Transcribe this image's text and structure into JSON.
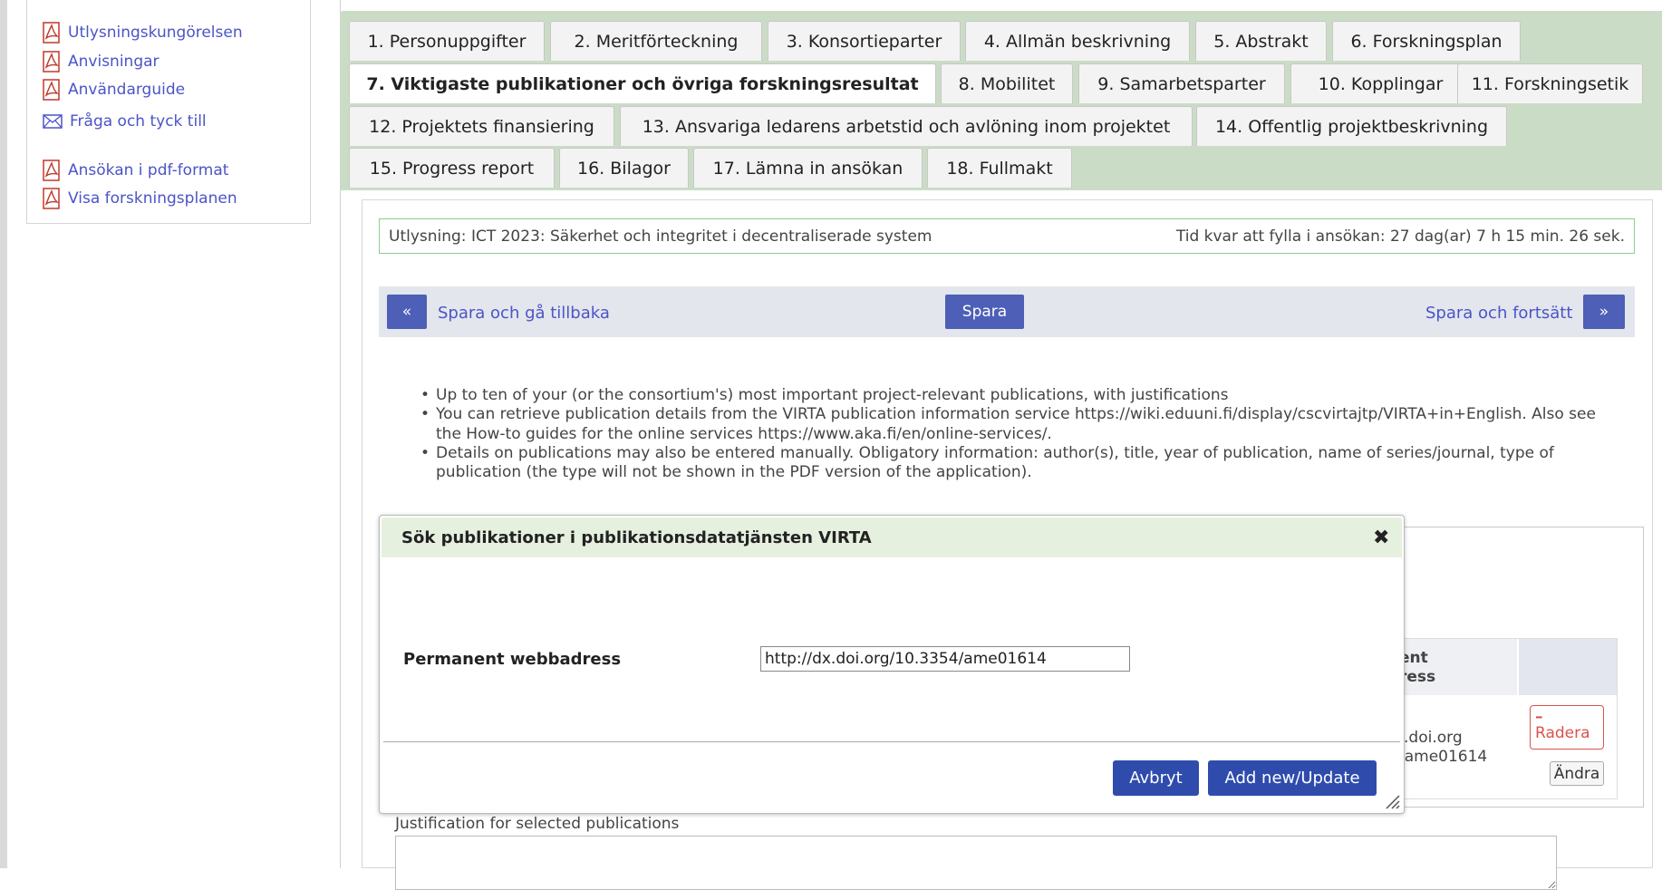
{
  "sidebar": {
    "links": [
      {
        "label": "Utlysningskungörelsen",
        "icon": "pdf-icon"
      },
      {
        "label": "Anvisningar",
        "icon": "pdf-icon"
      },
      {
        "label": "Användarguide",
        "icon": "pdf-icon"
      },
      {
        "label": "Fråga och tyck till",
        "icon": "mail-icon"
      },
      {
        "label": "Ansökan i pdf-format",
        "icon": "pdf-icon"
      },
      {
        "label": "Visa forskningsplanen",
        "icon": "pdf-icon"
      }
    ]
  },
  "tabs": [
    {
      "label": "1. Personuppgifter"
    },
    {
      "label": "2. Meritförteckning"
    },
    {
      "label": "3. Konsortieparter"
    },
    {
      "label": "4. Allmän beskrivning"
    },
    {
      "label": "5. Abstrakt"
    },
    {
      "label": "6. Forskningsplan"
    },
    {
      "label": "7. Viktigaste publikationer och övriga forskningsresultat",
      "active": true
    },
    {
      "label": "8. Mobilitet"
    },
    {
      "label": "9. Samarbetsparter"
    },
    {
      "label": "10. Kopplingar"
    },
    {
      "label": "11. Forskningsetik"
    },
    {
      "label": "12. Projektets finansiering"
    },
    {
      "label": "13. Ansvariga ledarens arbetstid och avlöning inom projektet"
    },
    {
      "label": "14. Offentlig projektbeskrivning"
    },
    {
      "label": "15. Progress report"
    },
    {
      "label": "16. Bilagor"
    },
    {
      "label": "17. Lämna in ansökan"
    },
    {
      "label": "18. Fullmakt"
    }
  ],
  "call": {
    "title": "Utlysning: ICT 2023: Säkerhet och integritet i decentraliserade system",
    "time_left": "Tid kvar att fylla i ansökan: 27 dag(ar) 7 h 15 min. 26 sek."
  },
  "nav": {
    "back_icon": "«",
    "back_label": "Spara och gå tillbaka",
    "save_label": "Spara",
    "forward_label": "Spara och fortsätt",
    "forward_icon": "»"
  },
  "instructions": [
    "Up to ten of your (or the consortium's) most important project-relevant publications, with justifications",
    "You can retrieve publication details from the VIRTA publication information service https://wiki.eduuni.fi/display/cscvirtajtp/VIRTA+in+English. Also see the How-to guides for the online services https://www.aka.fi/en/online-services/.",
    "Details on publications may also be entered manually. Obligatory information: author(s), title, year of publication, name of series/journal, type of publication (the type will not be shown in the PDF version of the application)."
  ],
  "table_behind": {
    "header_line1": "ent",
    "header_line2": "ress",
    "cell_line1": ".doi.org",
    "cell_line2": "/ame01614",
    "delete_icon": "–",
    "delete_label": "Radera",
    "edit_label": "Ändra"
  },
  "justification": {
    "label": "Justification for selected publications",
    "value": ""
  },
  "dialog": {
    "title": "Sök publikationer i publikationsdatatjänsten VIRTA",
    "close_icon": "✖",
    "field_label": "Permanent webbadress",
    "field_value": "http://dx.doi.org/10.3354/ame01614",
    "cancel_label": "Avbryt",
    "submit_label": "Add new/Update"
  }
}
